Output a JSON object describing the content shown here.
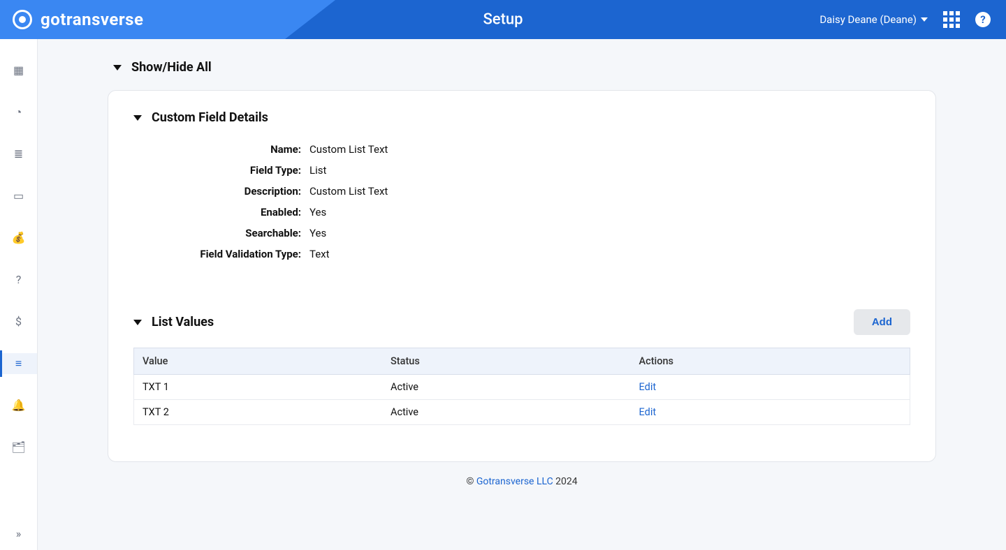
{
  "header": {
    "brand": "gotransverse",
    "title": "Setup",
    "user_label": "Daisy Deane (Deane)"
  },
  "sidebar": {
    "items": [
      {
        "name": "dashboard",
        "glyph": "▦"
      },
      {
        "name": "history",
        "glyph": "◔"
      },
      {
        "name": "lists",
        "glyph": "≣"
      },
      {
        "name": "documents",
        "glyph": "▭"
      },
      {
        "name": "money-bag",
        "glyph": "💰"
      },
      {
        "name": "support",
        "glyph": "?"
      },
      {
        "name": "currency",
        "glyph": "$"
      },
      {
        "name": "setup",
        "glyph": "≡",
        "active": true
      },
      {
        "name": "notifications",
        "glyph": "🔔"
      },
      {
        "name": "records",
        "glyph": "🗂"
      }
    ],
    "expand_glyph": "»"
  },
  "toggle_all": {
    "label": "Show/Hide All"
  },
  "details_section": {
    "title": "Custom Field Details",
    "rows": [
      {
        "label": "Name:",
        "value": "Custom List Text"
      },
      {
        "label": "Field Type:",
        "value": "List"
      },
      {
        "label": "Description:",
        "value": "Custom List Text"
      },
      {
        "label": "Enabled:",
        "value": "Yes"
      },
      {
        "label": "Searchable:",
        "value": "Yes"
      },
      {
        "label": "Field Validation Type:",
        "value": "Text"
      }
    ]
  },
  "list_values_section": {
    "title": "List Values",
    "add_label": "Add",
    "columns": {
      "value": "Value",
      "status": "Status",
      "actions": "Actions"
    },
    "rows": [
      {
        "value": "TXT 1",
        "status": "Active",
        "action": "Edit"
      },
      {
        "value": "TXT 2",
        "status": "Active",
        "action": "Edit"
      }
    ]
  },
  "footer": {
    "prefix": "© ",
    "link": "Gotransverse LLC",
    "year": " 2024"
  }
}
